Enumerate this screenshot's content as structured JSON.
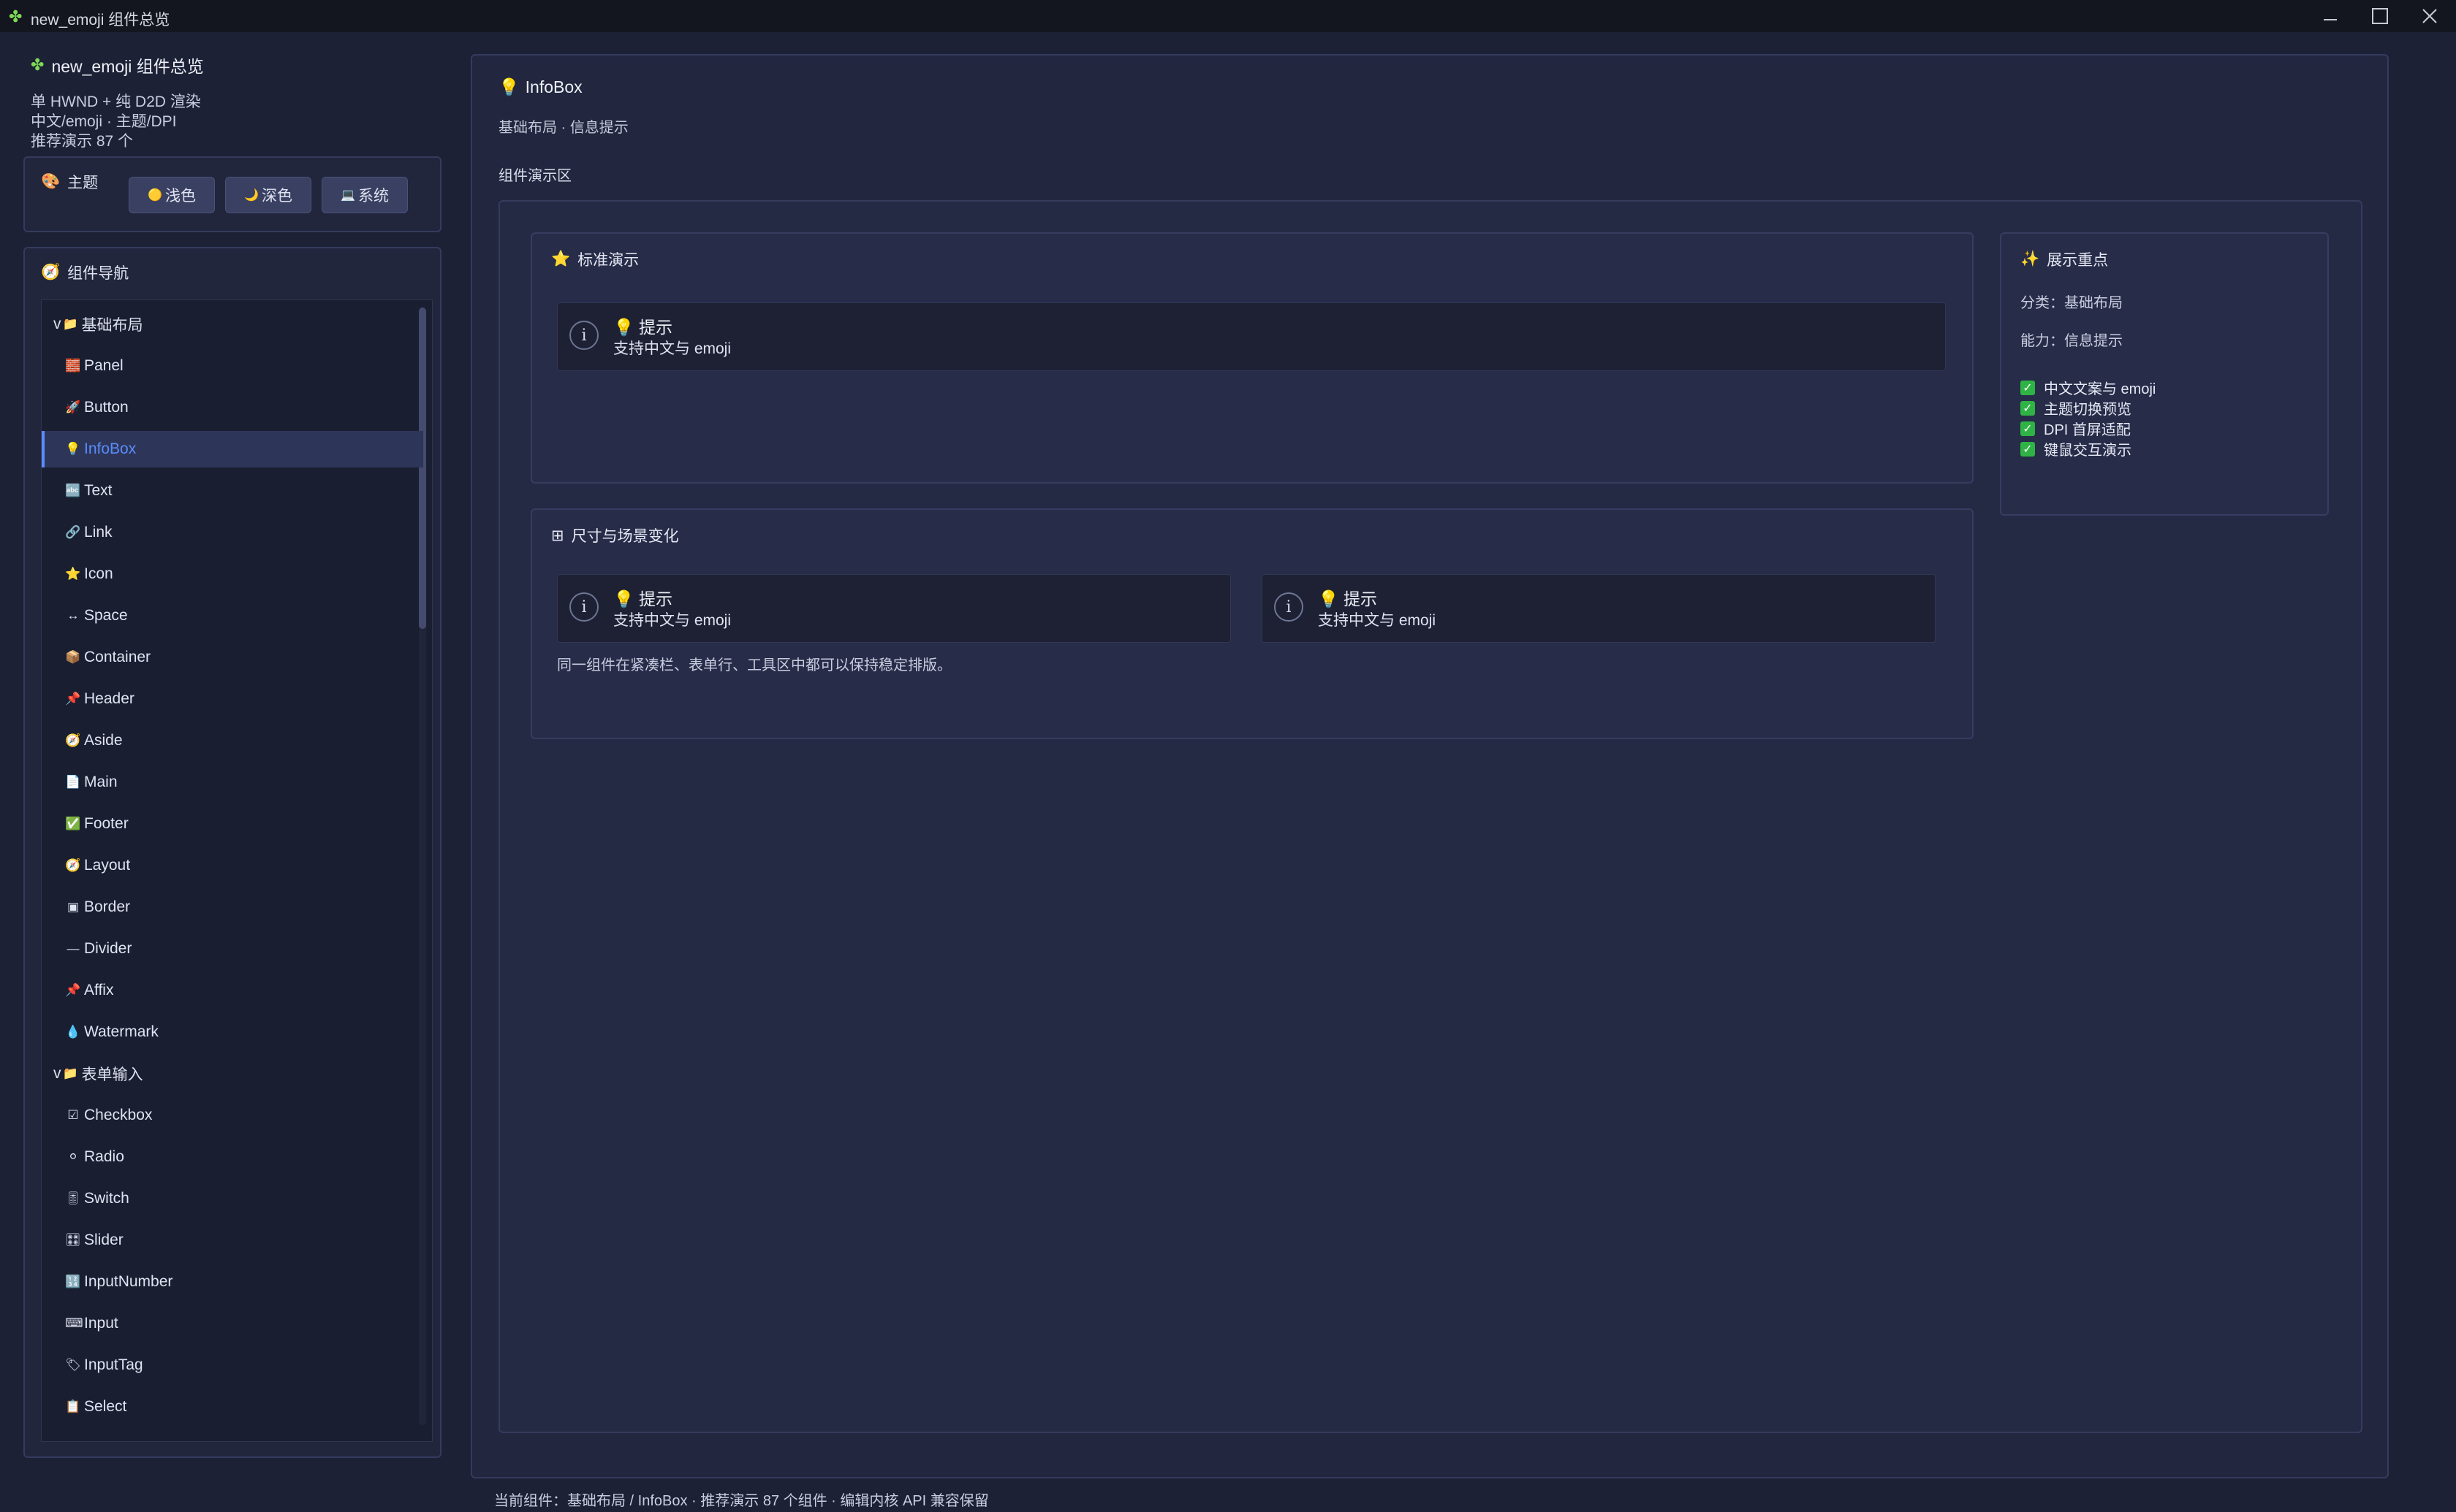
{
  "window": {
    "title": "new_emoji 组件总览",
    "icon": "puzzle-icon"
  },
  "sidebar": {
    "app_name": "new_emoji 组件总览",
    "desc_lines": [
      "单 HWND + 纯 D2D 渲染",
      "中文/emoji · 主题/DPI",
      "推荐演示 87 个"
    ],
    "theme": {
      "label": "主题",
      "buttons": [
        {
          "icon": "🟡",
          "label": "浅色"
        },
        {
          "icon": "🌙",
          "label": "深色"
        },
        {
          "icon": "💻",
          "label": "系统"
        }
      ]
    },
    "nav": {
      "label": "组件导航",
      "items": [
        {
          "type": "group",
          "label": "基础布局",
          "icon": "📁",
          "prefix": "v"
        },
        {
          "type": "child",
          "label": "Panel",
          "icon": "🧱"
        },
        {
          "type": "child",
          "label": "Button",
          "icon": "🚀"
        },
        {
          "type": "child",
          "label": "InfoBox",
          "icon": "💡",
          "active": true
        },
        {
          "type": "child",
          "label": "Text",
          "icon": "🔤"
        },
        {
          "type": "child",
          "label": "Link",
          "icon": "🔗"
        },
        {
          "type": "child",
          "label": "Icon",
          "icon": "⭐"
        },
        {
          "type": "child",
          "label": "Space",
          "icon": "↔"
        },
        {
          "type": "child",
          "label": "Container",
          "icon": "📦"
        },
        {
          "type": "child",
          "label": "Header",
          "icon": "📌"
        },
        {
          "type": "child",
          "label": "Aside",
          "icon": "🧭"
        },
        {
          "type": "child",
          "label": "Main",
          "icon": "📄"
        },
        {
          "type": "child",
          "label": "Footer",
          "icon": "✅"
        },
        {
          "type": "child",
          "label": "Layout",
          "icon": "🧭"
        },
        {
          "type": "child",
          "label": "Border",
          "icon": "▣"
        },
        {
          "type": "child",
          "label": "Divider",
          "icon": "—"
        },
        {
          "type": "child",
          "label": "Affix",
          "icon": "📌"
        },
        {
          "type": "child",
          "label": "Watermark",
          "icon": "💧"
        },
        {
          "type": "group",
          "label": "表单输入",
          "icon": "📁",
          "prefix": "v"
        },
        {
          "type": "child",
          "label": "Checkbox",
          "icon": "☑"
        },
        {
          "type": "child",
          "label": "Radio",
          "icon": "⚪"
        },
        {
          "type": "child",
          "label": "Switch",
          "icon": "🎚"
        },
        {
          "type": "child",
          "label": "Slider",
          "icon": "🎛"
        },
        {
          "type": "child",
          "label": "InputNumber",
          "icon": "🔢"
        },
        {
          "type": "child",
          "label": "Input",
          "icon": "⌨"
        },
        {
          "type": "child",
          "label": "InputTag",
          "icon": "🏷"
        },
        {
          "type": "child",
          "label": "Select",
          "icon": "📋"
        }
      ]
    }
  },
  "main": {
    "title": "InfoBox",
    "title_icon": "💡",
    "subtitle": "基础布局 · 信息提示",
    "demo_label": "组件演示区",
    "standard_card": {
      "title": "标准演示",
      "icon": "⭐",
      "infobox": {
        "title": "💡 提示",
        "body": "支持中文与 emoji"
      }
    },
    "size_card": {
      "title": "尺寸与场景变化",
      "icon": "⊞",
      "infoboxes": [
        {
          "title": "💡 提示",
          "body": "支持中文与 emoji"
        },
        {
          "title": "💡 提示",
          "body": "支持中文与 emoji"
        }
      ],
      "note": "同一组件在紧凑栏、表单行、工具区中都可以保持稳定排版。"
    },
    "focus_card": {
      "title": "展示重点",
      "icon": "✨",
      "category": "分类：基础布局",
      "ability": "能力：信息提示",
      "checks": [
        "中文文案与 emoji",
        "主题切换预览",
        "DPI 首屏适配",
        "键鼠交互演示"
      ]
    }
  },
  "status_bar": "当前组件：基础布局 / InfoBox · 推荐演示 87 个组件 · 编辑内核 API 兼容保留"
}
